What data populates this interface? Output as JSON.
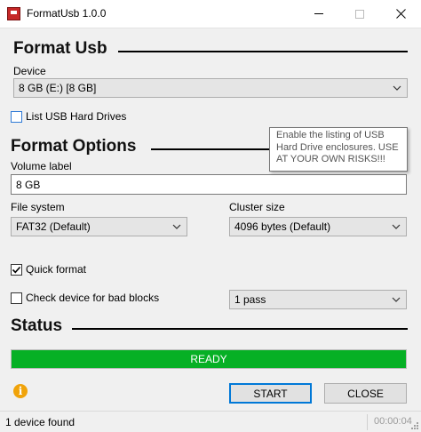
{
  "window": {
    "title": "FormatUsb 1.0.0",
    "minimize_glyph": "minimize-icon",
    "maximize_glyph": "maximize-icon",
    "close_glyph": "close-icon"
  },
  "format_usb": {
    "header": "Format Usb",
    "device_label": "Device",
    "device_value": "8 GB (E:) [8 GB]",
    "list_usb_label": "List USB Hard Drives",
    "list_usb_checked": false
  },
  "tooltip": {
    "text": "Enable the listing of USB Hard Drive enclosures. USE AT YOUR OWN RISKS!!!"
  },
  "format_options": {
    "header": "Format Options",
    "volume_label_label": "Volume label",
    "volume_label_value": "8 GB",
    "file_system_label": "File system",
    "file_system_value": "FAT32 (Default)",
    "cluster_size_label": "Cluster size",
    "cluster_size_value": "4096 bytes (Default)",
    "quick_format_label": "Quick format",
    "quick_format_checked": true,
    "bad_blocks_label": "Check device for bad blocks",
    "bad_blocks_checked": false,
    "passes_value": "1 pass"
  },
  "status": {
    "header": "Status",
    "progress_text": "READY",
    "progress_fraction": 1.0,
    "progress_color": "#06b025"
  },
  "actions": {
    "start_label": "START",
    "close_label": "CLOSE",
    "info_glyph": "i"
  },
  "statusbar": {
    "text": "1 device found",
    "timer": "00:00:04"
  },
  "colors": {
    "accent": "#0078d7",
    "info": "#f0a30a"
  }
}
